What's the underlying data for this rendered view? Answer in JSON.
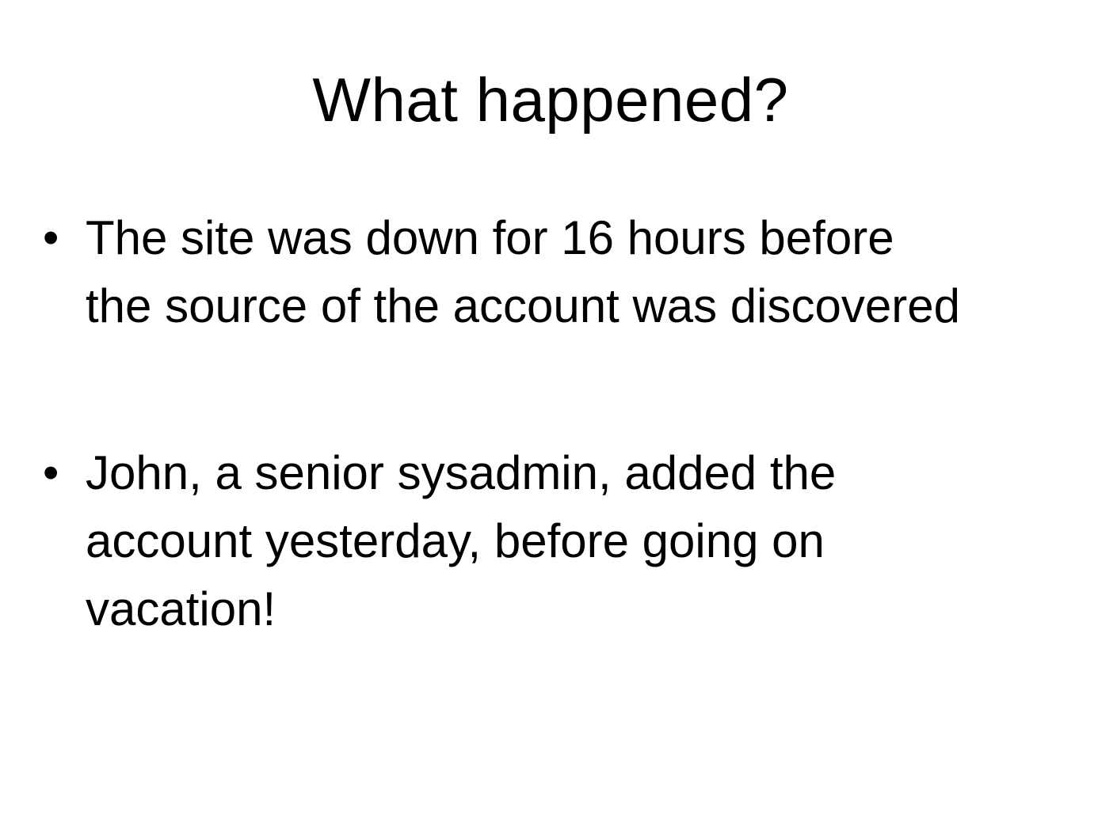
{
  "slide": {
    "title": "What happened?",
    "bullet_symbol": "•",
    "bullets": [
      {
        "lines": [
          "The site was down for 16 hours before",
          "the source of the account was discovered"
        ]
      },
      {
        "lines": [
          "John, a senior sysadmin, added the",
          "account yesterday, before going on",
          "vacation!"
        ]
      }
    ]
  }
}
